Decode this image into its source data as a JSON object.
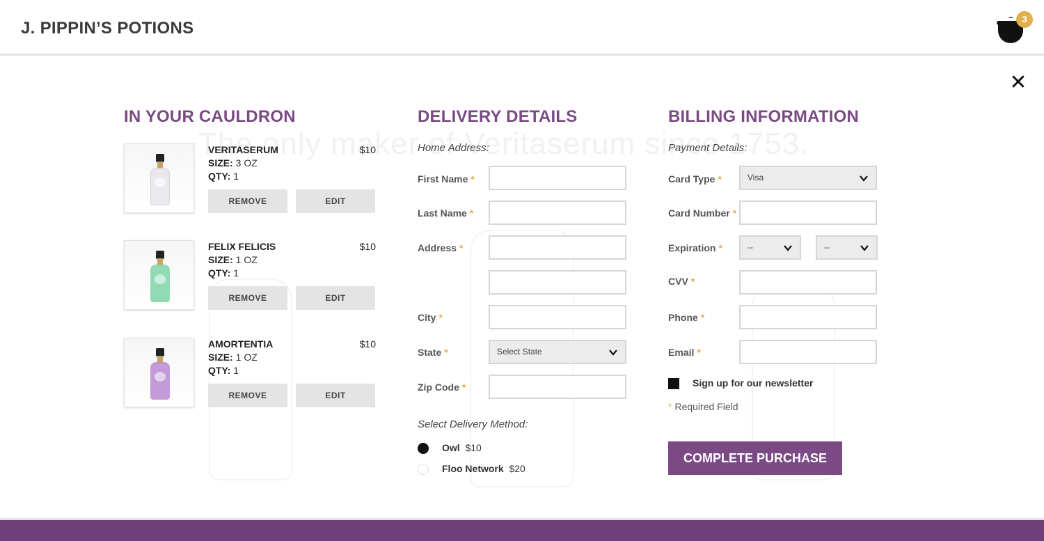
{
  "header": {
    "brand": "J. PIPPIN’S POTIONS",
    "cart_count": "3"
  },
  "ghost_text": "The only maker of Veritaserum since 1753.",
  "cart": {
    "title": "IN YOUR CAULDRON",
    "remove_label": "REMOVE",
    "edit_label": "EDIT",
    "size_label": "SIZE:",
    "qty_label": "QTY:",
    "items": [
      {
        "name": "VERITASERUM",
        "price": "$10",
        "size": "3 OZ",
        "qty": "1",
        "color": "#e8e6ec"
      },
      {
        "name": "FELIX FELICIS",
        "price": "$10",
        "size": "1 OZ",
        "qty": "1",
        "color": "#7fd3a6"
      },
      {
        "name": "AMORTENTIA",
        "price": "$10",
        "size": "1 OZ",
        "qty": "1",
        "color": "#b98ad1"
      }
    ]
  },
  "delivery": {
    "title": "DELIVERY DETAILS",
    "home_address": "Home Address:",
    "first_name": "First Name",
    "last_name": "Last Name",
    "address": "Address",
    "city": "City",
    "state": "State",
    "state_value": "Select State",
    "zip": "Zip Code",
    "method_label": "Select Delivery Method:",
    "methods": [
      {
        "name": "Owl",
        "price": "$10",
        "selected": true
      },
      {
        "name": "Floo Network",
        "price": "$20",
        "selected": false
      }
    ]
  },
  "billing": {
    "title": "BILLING INFORMATION",
    "payment_details": "Payment Details:",
    "card_type": "Card Type",
    "card_type_value": "Visa",
    "card_number": "Card Number",
    "expiration": "Expiration",
    "exp_month": "--",
    "exp_year": "--",
    "cvv": "CVV",
    "phone": "Phone",
    "email": "Email",
    "newsletter": "Sign up for our newsletter",
    "required_note": "Required Field",
    "submit": "COMPLETE PURCHASE"
  },
  "required_mark": "*",
  "colors": {
    "accent": "#7b4a85",
    "required": "#e2b04a"
  }
}
